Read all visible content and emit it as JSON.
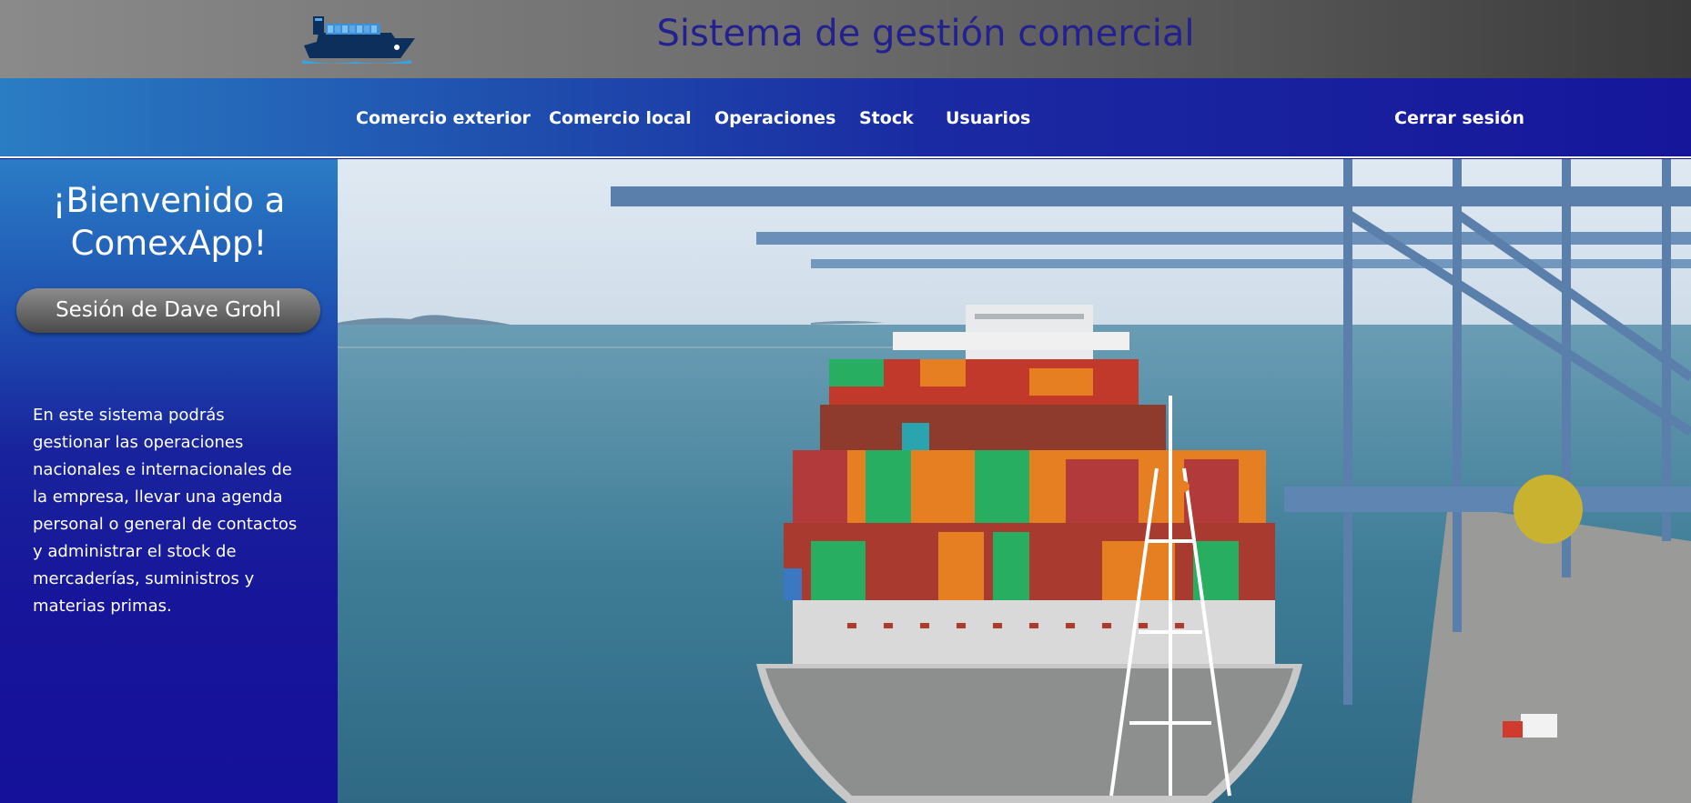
{
  "header": {
    "title": "Sistema de gestión comercial",
    "logo_icon": "cargo-ship-icon"
  },
  "nav": {
    "items": [
      {
        "label": "Comercio exterior"
      },
      {
        "label": "Comercio local"
      },
      {
        "label": "Operaciones"
      },
      {
        "label": "Stock"
      },
      {
        "label": "Usuarios"
      }
    ],
    "logout": "Cerrar sesión"
  },
  "sidebar": {
    "welcome_line1": "¡Bienvenido a",
    "welcome_line2": "ComexApp!",
    "session": "Sesión de Dave Grohl",
    "description": "En este sistema podrás gestionar las operaciones nacionales e internacionales de la empresa, llevar una agenda personal o general de contactos y administrar el stock de mercaderías, suministros y materias primas."
  },
  "hero": {
    "image": "container-ship-port-photo"
  },
  "colors": {
    "title": "#23208f",
    "nav_start": "#2a7dc3",
    "nav_end": "#16169a",
    "sidebar_bottom": "#15119a"
  }
}
